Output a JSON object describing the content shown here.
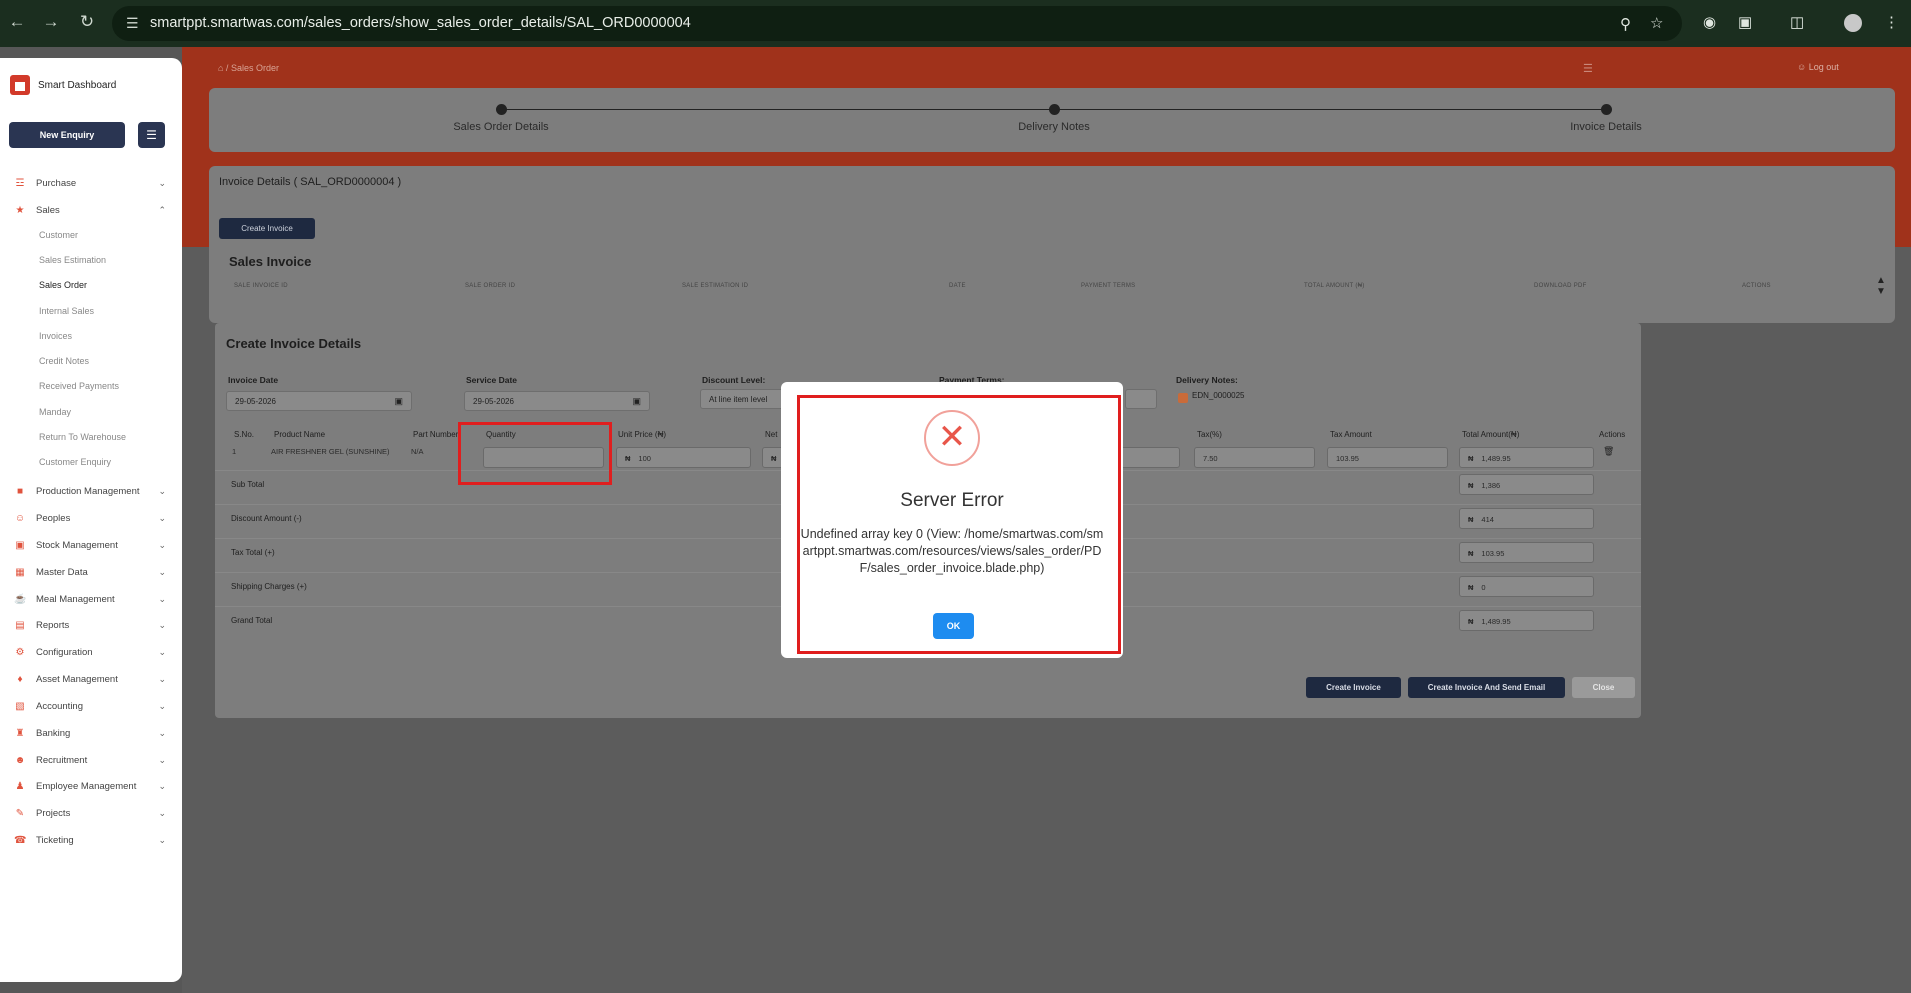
{
  "browser": {
    "url": "smartppt.smartwas.com/sales_orders/show_sales_order_details/SAL_ORD0000004"
  },
  "sidebar": {
    "brand": "Smart Dashboard",
    "new_enquiry": "New Enquiry",
    "items": [
      {
        "label": "Purchase",
        "icon": "cart-icon"
      },
      {
        "label": "Sales",
        "icon": "sales-icon"
      },
      {
        "label": "Production Management",
        "icon": "factory-icon"
      },
      {
        "label": "Peoples",
        "icon": "people-icon"
      },
      {
        "label": "Stock Management",
        "icon": "box-icon"
      },
      {
        "label": "Master Data",
        "icon": "database-icon"
      },
      {
        "label": "Meal Management",
        "icon": "meal-icon"
      },
      {
        "label": "Reports",
        "icon": "report-icon"
      },
      {
        "label": "Configuration",
        "icon": "gear-icon"
      },
      {
        "label": "Asset Management",
        "icon": "asset-icon"
      },
      {
        "label": "Accounting",
        "icon": "calculator-icon"
      },
      {
        "label": "Banking",
        "icon": "bank-icon"
      },
      {
        "label": "Recruitment",
        "icon": "recruit-icon"
      },
      {
        "label": "Employee Management",
        "icon": "employee-icon"
      },
      {
        "label": "Projects",
        "icon": "project-icon"
      },
      {
        "label": "Ticketing",
        "icon": "ticket-icon"
      }
    ],
    "sales_sub": [
      "Customer",
      "Sales Estimation",
      "Sales Order",
      "Internal Sales",
      "Invoices",
      "Credit Notes",
      "Received Payments",
      "Manday",
      "Return To Warehouse",
      "Customer Enquiry"
    ]
  },
  "header": {
    "breadcrumb": "Sales Order",
    "logout": "Log out"
  },
  "stepper": [
    "Sales Order Details",
    "Delivery Notes",
    "Invoice Details"
  ],
  "invoice_panel": {
    "title": "Invoice Details ( SAL_ORD0000004 )",
    "create_button": "Create Invoice",
    "section": "Sales Invoice",
    "columns": [
      "SALE INVOICE ID",
      "SALE ORDER ID",
      "SALE ESTIMATION ID",
      "DATE",
      "PAYMENT TERMS",
      "TOTAL AMOUNT (₦)",
      "DOWNLOAD PDF",
      "ACTIONS"
    ]
  },
  "modal": {
    "title": "Create Invoice Details",
    "invoice_date_label": "Invoice Date",
    "invoice_date": "29-05-2026",
    "service_date_label": "Service Date",
    "service_date": "29-05-2026",
    "discount_level_label": "Discount Level:",
    "discount_level": "At line item level",
    "payment_terms_label": "Payment Terms:",
    "delivery_notes_label": "Delivery Notes:",
    "delivery_note": "EDN_0000025",
    "columns": {
      "sno": "S.No.",
      "product": "Product Name",
      "part": "Part Number",
      "qty": "Quantity",
      "unit_price": "Unit Price (₦)",
      "net": "Net",
      "tax": "Tax(%)",
      "tax_amount": "Tax Amount",
      "total": "Total Amount(₦)",
      "actions": "Actions"
    },
    "row": {
      "sno": "1",
      "product": "AIR FRESHNER GEL (SUNSHINE)",
      "part": "N/A",
      "qty": "",
      "unit_price": "100",
      "tax": "7.50",
      "tax_amount": "103.95",
      "total": "1,489.95"
    },
    "currency": "₦",
    "summary": [
      {
        "label": "Sub Total",
        "value": "1,386"
      },
      {
        "label": "Discount Amount (-)",
        "value": "414"
      },
      {
        "label": "Tax Total (+)",
        "value": "103.95"
      },
      {
        "label": "Shipping Charges (+)",
        "value": "0"
      },
      {
        "label": "Grand Total",
        "value": "1,489.95"
      }
    ],
    "buttons": {
      "create": "Create Invoice",
      "create_send": "Create Invoice And Send Email",
      "close": "Close"
    }
  },
  "error_dialog": {
    "title": "Server Error",
    "message": "Undefined array key 0 (View: /home/smartwas.com/smartppt.smartwas.com/resources/views/sales_order/PDF/sales_order_invoice.blade.php)",
    "ok": "OK"
  },
  "colors": {
    "accent_red": "#a0321b",
    "navy": "#2a3552",
    "ok_blue": "#1e8cf0",
    "highlight": "#e01e1e"
  }
}
